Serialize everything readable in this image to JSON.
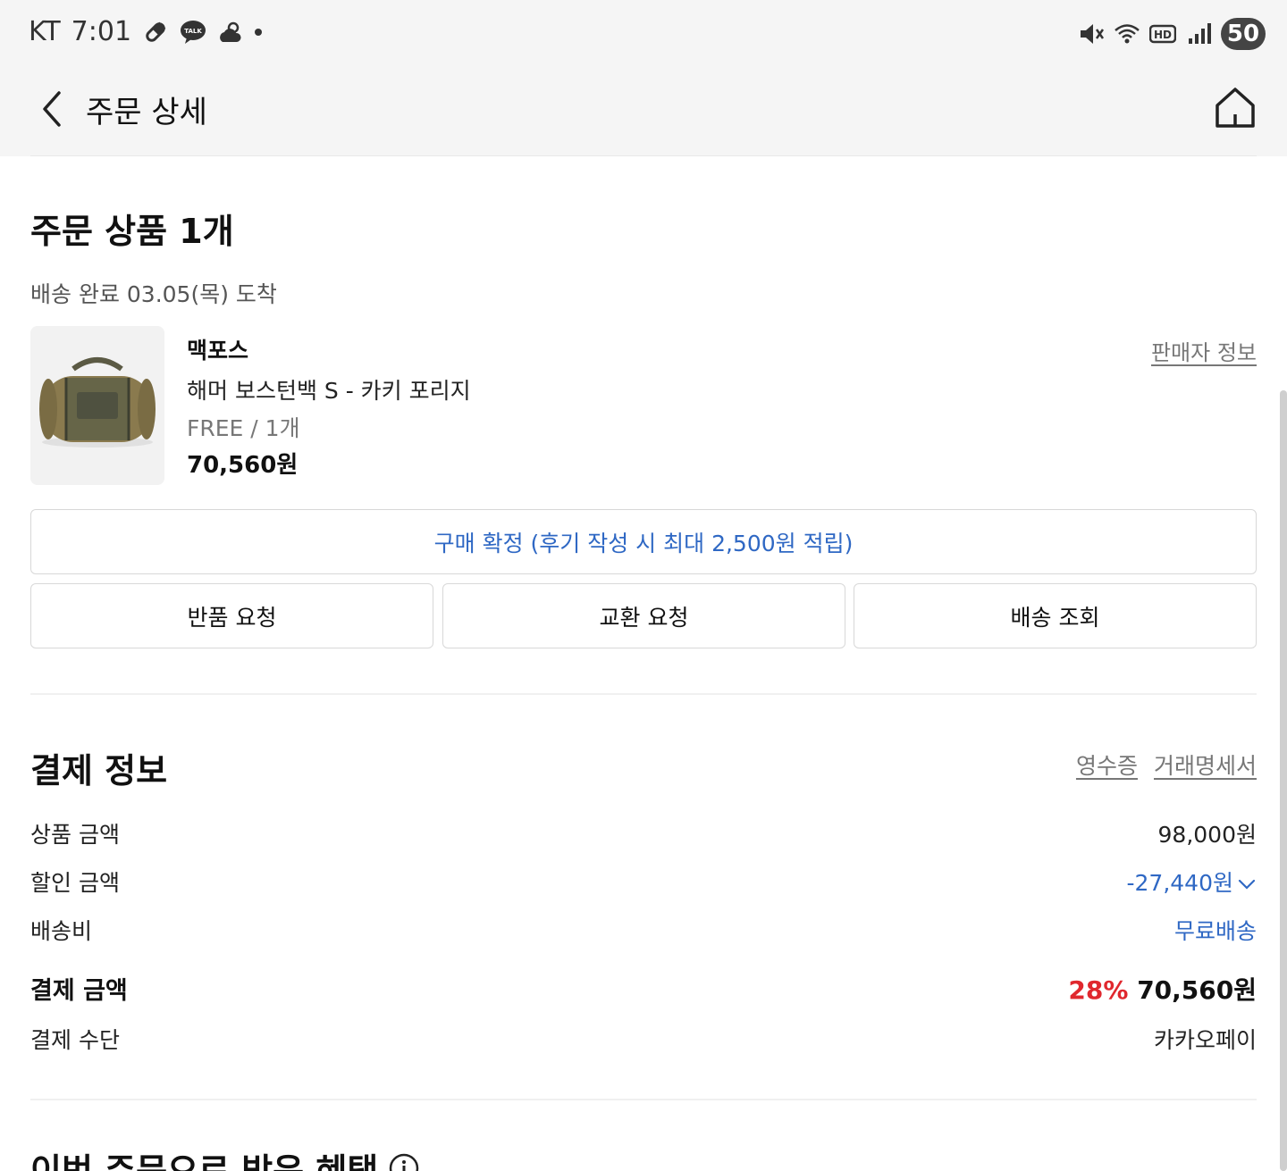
{
  "status_bar": {
    "carrier": "KT",
    "time": "7:01",
    "battery": "50"
  },
  "header": {
    "title": "주문 상세"
  },
  "order": {
    "section_title": "주문 상품 1개",
    "delivery_status": "배송 완료 03.05(목) 도착",
    "product": {
      "brand": "맥포스",
      "name": "해머 보스턴백 S - 카키 포리지",
      "option": "FREE / 1개",
      "price": "70,560원"
    },
    "seller_link": "판매자 정보",
    "confirm_button": "구매 확정 (후기 작성 시 최대 2,500원 적립)",
    "actions": [
      "반품 요청",
      "교환 요청",
      "배송 조회"
    ]
  },
  "payment": {
    "section_title": "결제 정보",
    "receipt_link": "영수증",
    "statement_link": "거래명세서",
    "rows": {
      "product_amount_label": "상품 금액",
      "product_amount_value": "98,000원",
      "discount_label": "할인 금액",
      "discount_value": "-27,440원",
      "shipping_label": "배송비",
      "shipping_value": "무료배송",
      "total_label": "결제 금액",
      "total_discount_rate": "28%",
      "total_value": "70,560원",
      "method_label": "결제 수단",
      "method_value": "카카오페이"
    }
  },
  "benefits": {
    "section_title": "이번 주문으로 받은 혜택"
  },
  "colors": {
    "accent_blue": "#2f68c4",
    "discount_red": "#e0282e",
    "header_bg": "#f5f5f5"
  },
  "icons": [
    "back-arrow-icon",
    "home-icon",
    "info-icon",
    "chevron-down-icon",
    "mute-icon",
    "wifi-icon",
    "hd-icon",
    "signal-icon",
    "kakaotalk-icon",
    "weather-icon",
    "pill-icon"
  ]
}
